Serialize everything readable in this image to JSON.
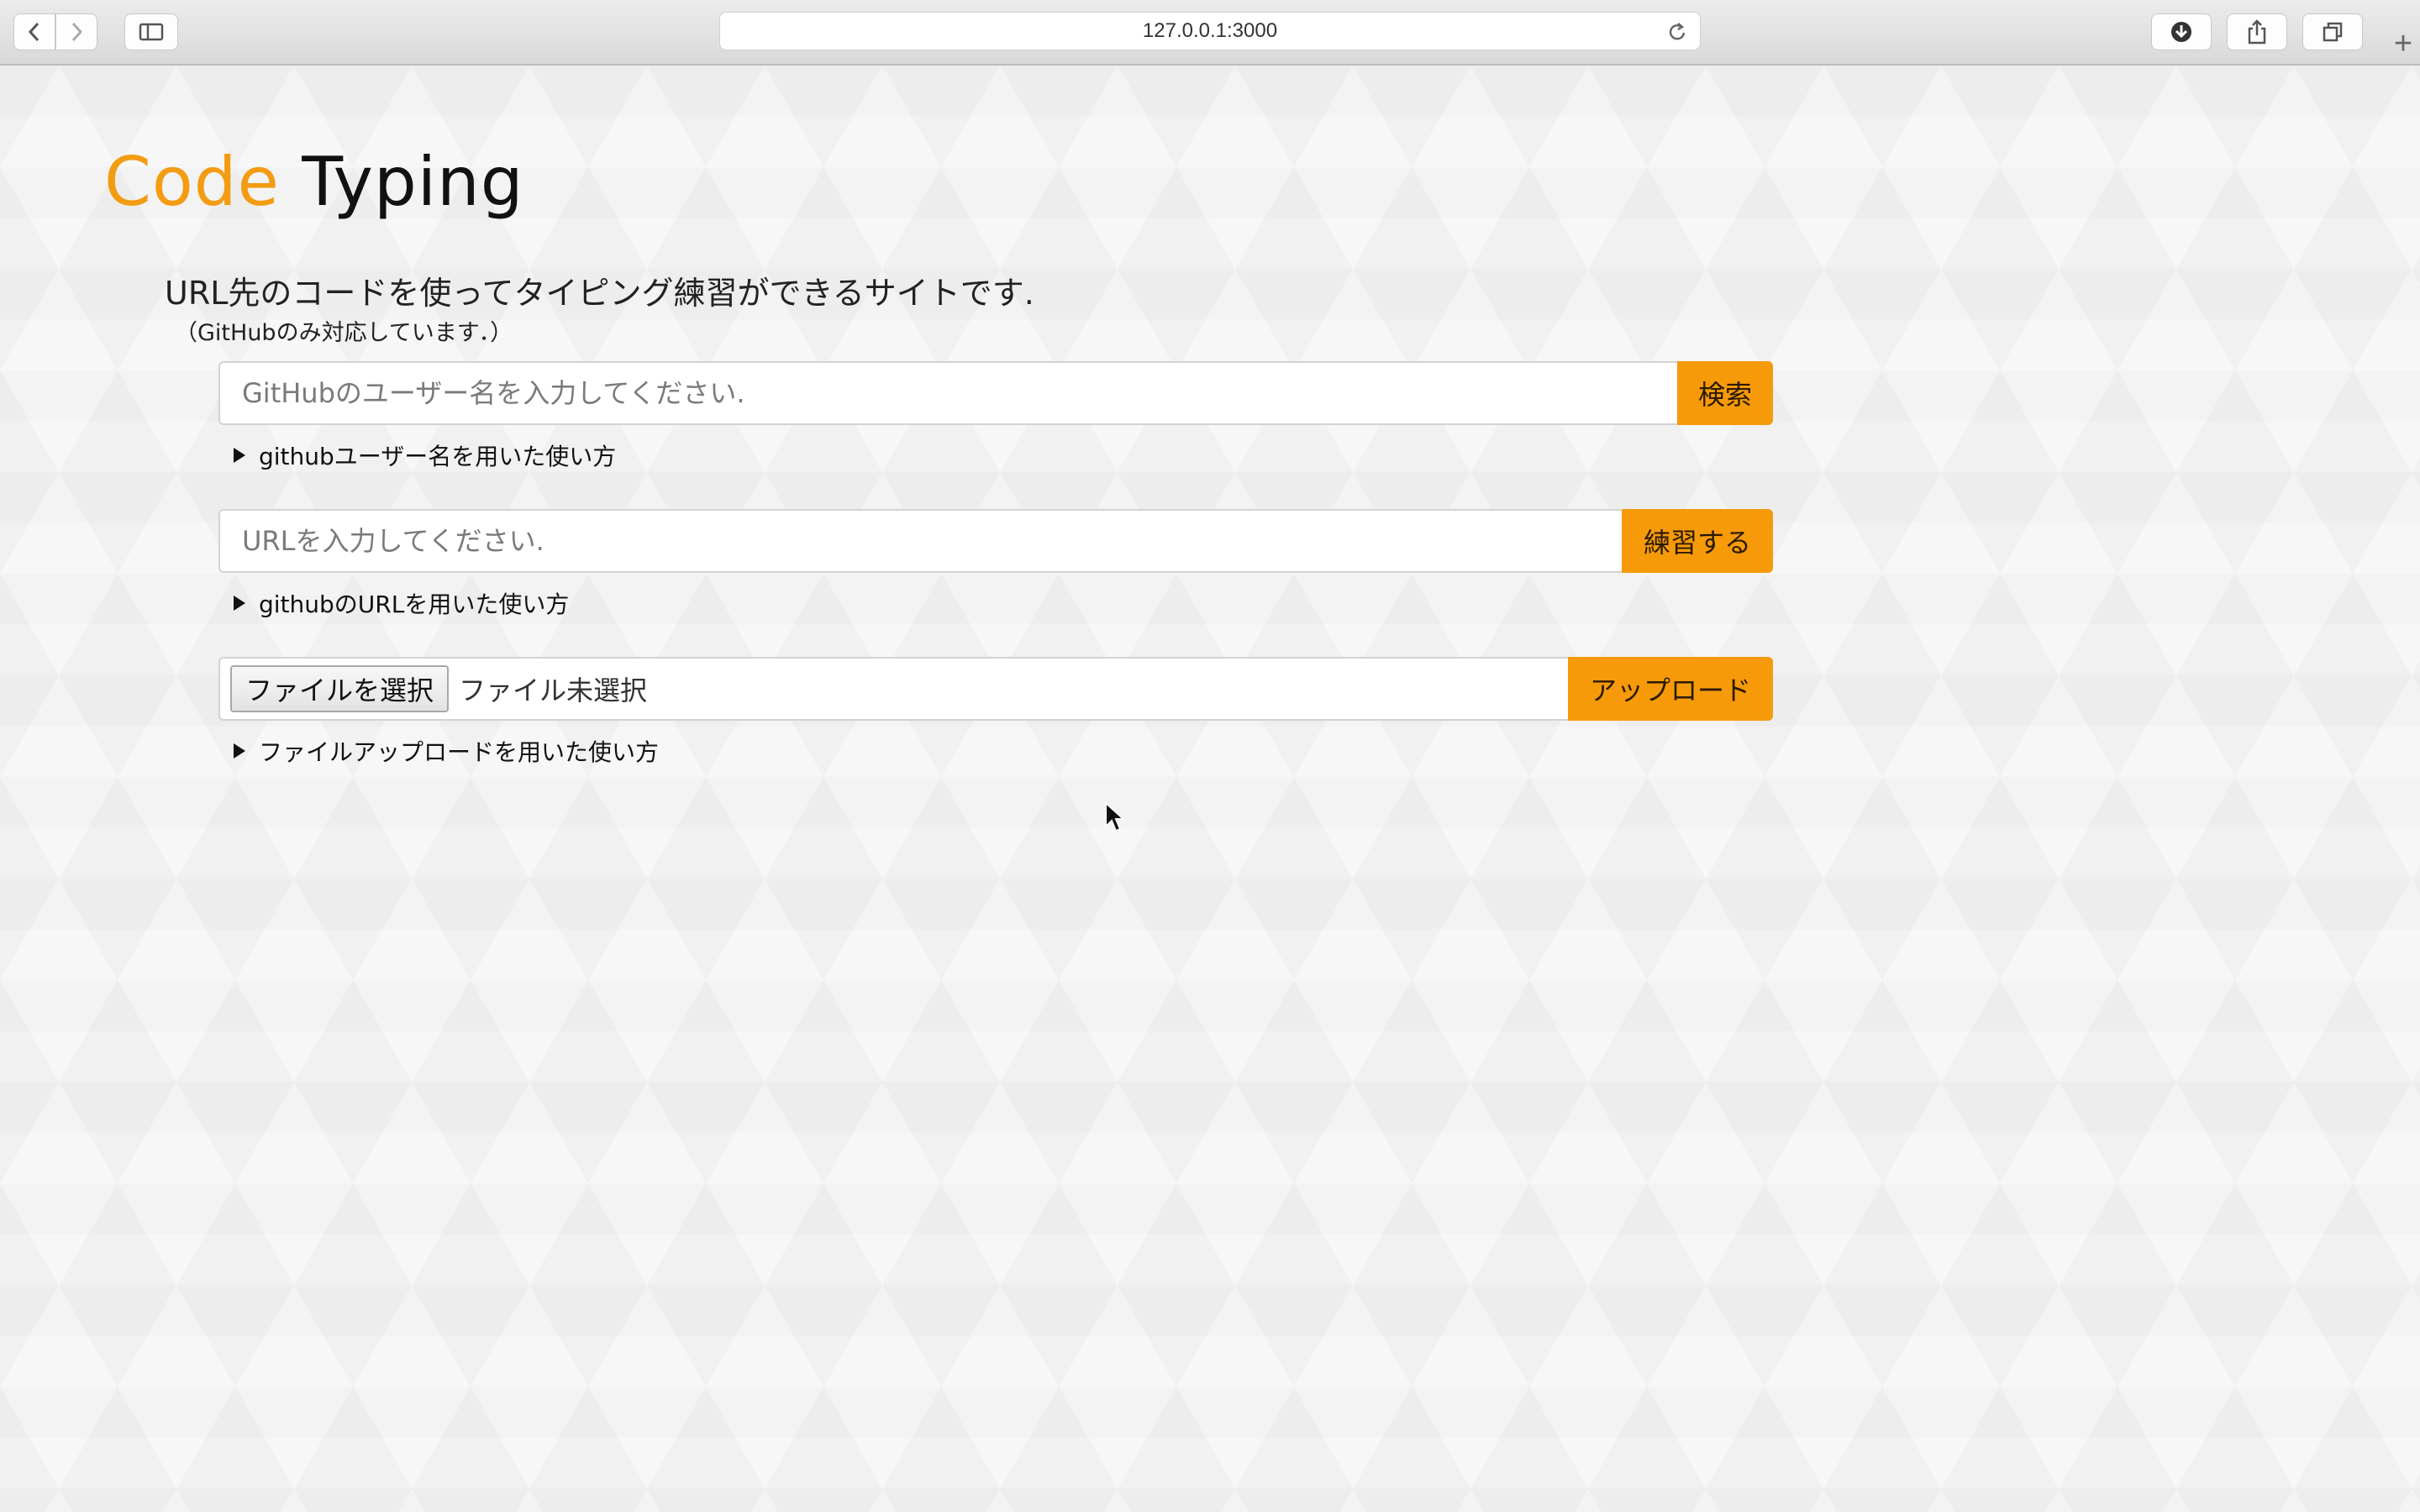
{
  "browser": {
    "url": "127.0.0.1:3000",
    "icons": {
      "back": "chevron-left-icon",
      "forward": "chevron-right-icon",
      "sidebar": "sidebar-icon",
      "reload": "reload-icon",
      "downloads": "download-icon",
      "share": "share-icon",
      "tabs": "tabs-icon",
      "new_tab": "+"
    }
  },
  "header": {
    "logo_part1": "Code",
    "logo_part2": "Typing",
    "logo_colors": {
      "part1": "#f39c12",
      "part2": "#111111"
    }
  },
  "intro": {
    "description": "URL先のコードを使ってタイピング練習ができるサイトです.",
    "note": "（GitHubのみ対応しています．）"
  },
  "forms": {
    "github_user": {
      "placeholder": "GitHubのユーザー名を入力してください.",
      "value": "",
      "button_label": "検索",
      "howto": "githubユーザー名を用いた使い方"
    },
    "url": {
      "placeholder": "URLを入力してください.",
      "value": "",
      "button_label": "練習する",
      "howto": "githubのURLを用いた使い方"
    },
    "upload": {
      "file_button_label": "ファイルを選択",
      "file_status": "ファイル未選択",
      "button_label": "アップロード",
      "howto": "ファイルアップロードを用いた使い方"
    }
  },
  "theme": {
    "accent": "#f69a0a"
  }
}
